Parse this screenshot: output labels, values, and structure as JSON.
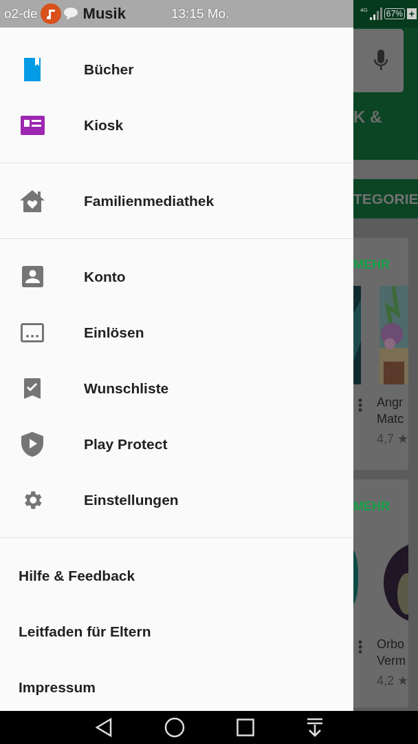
{
  "status_bar": {
    "carrier": "o2-de",
    "app_title": "Musik",
    "time": "13:15 Mo.",
    "network": "4G",
    "battery": "67%",
    "charge": "+"
  },
  "drawer": {
    "sections": [
      {
        "items": [
          {
            "label": "Bücher",
            "kind": "books"
          },
          {
            "label": "Kiosk",
            "kind": "kiosk"
          }
        ]
      },
      {
        "items": [
          {
            "label": "Familienmediathek",
            "kind": "family"
          }
        ]
      },
      {
        "items": [
          {
            "label": "Konto",
            "kind": "account"
          },
          {
            "label": "Einlösen",
            "kind": "redeem"
          },
          {
            "label": "Wunschliste",
            "kind": "wishlist"
          },
          {
            "label": "Play Protect",
            "kind": "protect"
          },
          {
            "label": "Einstellungen",
            "kind": "settings"
          }
        ]
      },
      {
        "items": [
          {
            "label": "Hilfe & Feedback",
            "kind": "text"
          },
          {
            "label": "Leitfaden für Eltern",
            "kind": "text"
          },
          {
            "label": "Impressum",
            "kind": "text"
          }
        ]
      }
    ]
  },
  "background": {
    "header_text": "K &",
    "tab_label": "TEGORIE",
    "cards": [
      {
        "more": "MEHR",
        "title_lines": [
          "Angr",
          "Matc"
        ],
        "rating": "4,7 ★"
      },
      {
        "more": "MEHR",
        "title_lines": [
          "Orbo",
          "Verm"
        ],
        "rating": "4,2 ★"
      }
    ]
  }
}
